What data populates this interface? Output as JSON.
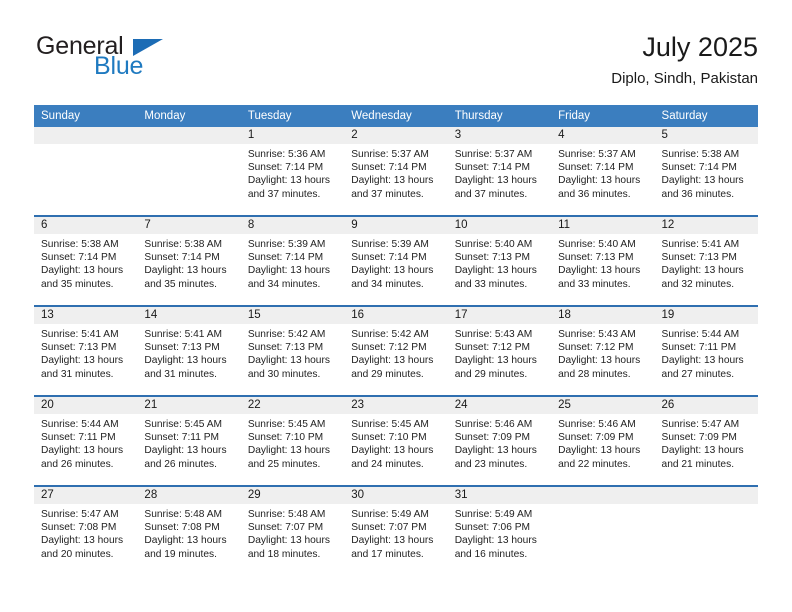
{
  "logo": {
    "word_one": "General",
    "word_two": "Blue",
    "triangle": "blue-triangle-icon"
  },
  "header": {
    "title": "July 2025",
    "location": "Diplo, Sindh, Pakistan"
  },
  "colors": {
    "header_blue": "#3b7ebf",
    "row_divider_blue": "#2f6fb0",
    "daynum_band": "#efefef",
    "logo_blue": "#1f7ac0",
    "text": "#1a1a1a"
  },
  "calendar": {
    "weekday_headers": [
      "Sunday",
      "Monday",
      "Tuesday",
      "Wednesday",
      "Thursday",
      "Friday",
      "Saturday"
    ],
    "weeks": [
      [
        {
          "day": "",
          "sunrise": "",
          "sunset": "",
          "daylight_line1": "",
          "daylight_line2": ""
        },
        {
          "day": "",
          "sunrise": "",
          "sunset": "",
          "daylight_line1": "",
          "daylight_line2": ""
        },
        {
          "day": "1",
          "sunrise": "Sunrise: 5:36 AM",
          "sunset": "Sunset: 7:14 PM",
          "daylight_line1": "Daylight: 13 hours",
          "daylight_line2": "and 37 minutes."
        },
        {
          "day": "2",
          "sunrise": "Sunrise: 5:37 AM",
          "sunset": "Sunset: 7:14 PM",
          "daylight_line1": "Daylight: 13 hours",
          "daylight_line2": "and 37 minutes."
        },
        {
          "day": "3",
          "sunrise": "Sunrise: 5:37 AM",
          "sunset": "Sunset: 7:14 PM",
          "daylight_line1": "Daylight: 13 hours",
          "daylight_line2": "and 37 minutes."
        },
        {
          "day": "4",
          "sunrise": "Sunrise: 5:37 AM",
          "sunset": "Sunset: 7:14 PM",
          "daylight_line1": "Daylight: 13 hours",
          "daylight_line2": "and 36 minutes."
        },
        {
          "day": "5",
          "sunrise": "Sunrise: 5:38 AM",
          "sunset": "Sunset: 7:14 PM",
          "daylight_line1": "Daylight: 13 hours",
          "daylight_line2": "and 36 minutes."
        }
      ],
      [
        {
          "day": "6",
          "sunrise": "Sunrise: 5:38 AM",
          "sunset": "Sunset: 7:14 PM",
          "daylight_line1": "Daylight: 13 hours",
          "daylight_line2": "and 35 minutes."
        },
        {
          "day": "7",
          "sunrise": "Sunrise: 5:38 AM",
          "sunset": "Sunset: 7:14 PM",
          "daylight_line1": "Daylight: 13 hours",
          "daylight_line2": "and 35 minutes."
        },
        {
          "day": "8",
          "sunrise": "Sunrise: 5:39 AM",
          "sunset": "Sunset: 7:14 PM",
          "daylight_line1": "Daylight: 13 hours",
          "daylight_line2": "and 34 minutes."
        },
        {
          "day": "9",
          "sunrise": "Sunrise: 5:39 AM",
          "sunset": "Sunset: 7:14 PM",
          "daylight_line1": "Daylight: 13 hours",
          "daylight_line2": "and 34 minutes."
        },
        {
          "day": "10",
          "sunrise": "Sunrise: 5:40 AM",
          "sunset": "Sunset: 7:13 PM",
          "daylight_line1": "Daylight: 13 hours",
          "daylight_line2": "and 33 minutes."
        },
        {
          "day": "11",
          "sunrise": "Sunrise: 5:40 AM",
          "sunset": "Sunset: 7:13 PM",
          "daylight_line1": "Daylight: 13 hours",
          "daylight_line2": "and 33 minutes."
        },
        {
          "day": "12",
          "sunrise": "Sunrise: 5:41 AM",
          "sunset": "Sunset: 7:13 PM",
          "daylight_line1": "Daylight: 13 hours",
          "daylight_line2": "and 32 minutes."
        }
      ],
      [
        {
          "day": "13",
          "sunrise": "Sunrise: 5:41 AM",
          "sunset": "Sunset: 7:13 PM",
          "daylight_line1": "Daylight: 13 hours",
          "daylight_line2": "and 31 minutes."
        },
        {
          "day": "14",
          "sunrise": "Sunrise: 5:41 AM",
          "sunset": "Sunset: 7:13 PM",
          "daylight_line1": "Daylight: 13 hours",
          "daylight_line2": "and 31 minutes."
        },
        {
          "day": "15",
          "sunrise": "Sunrise: 5:42 AM",
          "sunset": "Sunset: 7:13 PM",
          "daylight_line1": "Daylight: 13 hours",
          "daylight_line2": "and 30 minutes."
        },
        {
          "day": "16",
          "sunrise": "Sunrise: 5:42 AM",
          "sunset": "Sunset: 7:12 PM",
          "daylight_line1": "Daylight: 13 hours",
          "daylight_line2": "and 29 minutes."
        },
        {
          "day": "17",
          "sunrise": "Sunrise: 5:43 AM",
          "sunset": "Sunset: 7:12 PM",
          "daylight_line1": "Daylight: 13 hours",
          "daylight_line2": "and 29 minutes."
        },
        {
          "day": "18",
          "sunrise": "Sunrise: 5:43 AM",
          "sunset": "Sunset: 7:12 PM",
          "daylight_line1": "Daylight: 13 hours",
          "daylight_line2": "and 28 minutes."
        },
        {
          "day": "19",
          "sunrise": "Sunrise: 5:44 AM",
          "sunset": "Sunset: 7:11 PM",
          "daylight_line1": "Daylight: 13 hours",
          "daylight_line2": "and 27 minutes."
        }
      ],
      [
        {
          "day": "20",
          "sunrise": "Sunrise: 5:44 AM",
          "sunset": "Sunset: 7:11 PM",
          "daylight_line1": "Daylight: 13 hours",
          "daylight_line2": "and 26 minutes."
        },
        {
          "day": "21",
          "sunrise": "Sunrise: 5:45 AM",
          "sunset": "Sunset: 7:11 PM",
          "daylight_line1": "Daylight: 13 hours",
          "daylight_line2": "and 26 minutes."
        },
        {
          "day": "22",
          "sunrise": "Sunrise: 5:45 AM",
          "sunset": "Sunset: 7:10 PM",
          "daylight_line1": "Daylight: 13 hours",
          "daylight_line2": "and 25 minutes."
        },
        {
          "day": "23",
          "sunrise": "Sunrise: 5:45 AM",
          "sunset": "Sunset: 7:10 PM",
          "daylight_line1": "Daylight: 13 hours",
          "daylight_line2": "and 24 minutes."
        },
        {
          "day": "24",
          "sunrise": "Sunrise: 5:46 AM",
          "sunset": "Sunset: 7:09 PM",
          "daylight_line1": "Daylight: 13 hours",
          "daylight_line2": "and 23 minutes."
        },
        {
          "day": "25",
          "sunrise": "Sunrise: 5:46 AM",
          "sunset": "Sunset: 7:09 PM",
          "daylight_line1": "Daylight: 13 hours",
          "daylight_line2": "and 22 minutes."
        },
        {
          "day": "26",
          "sunrise": "Sunrise: 5:47 AM",
          "sunset": "Sunset: 7:09 PM",
          "daylight_line1": "Daylight: 13 hours",
          "daylight_line2": "and 21 minutes."
        }
      ],
      [
        {
          "day": "27",
          "sunrise": "Sunrise: 5:47 AM",
          "sunset": "Sunset: 7:08 PM",
          "daylight_line1": "Daylight: 13 hours",
          "daylight_line2": "and 20 minutes."
        },
        {
          "day": "28",
          "sunrise": "Sunrise: 5:48 AM",
          "sunset": "Sunset: 7:08 PM",
          "daylight_line1": "Daylight: 13 hours",
          "daylight_line2": "and 19 minutes."
        },
        {
          "day": "29",
          "sunrise": "Sunrise: 5:48 AM",
          "sunset": "Sunset: 7:07 PM",
          "daylight_line1": "Daylight: 13 hours",
          "daylight_line2": "and 18 minutes."
        },
        {
          "day": "30",
          "sunrise": "Sunrise: 5:49 AM",
          "sunset": "Sunset: 7:07 PM",
          "daylight_line1": "Daylight: 13 hours",
          "daylight_line2": "and 17 minutes."
        },
        {
          "day": "31",
          "sunrise": "Sunrise: 5:49 AM",
          "sunset": "Sunset: 7:06 PM",
          "daylight_line1": "Daylight: 13 hours",
          "daylight_line2": "and 16 minutes."
        },
        {
          "day": "",
          "sunrise": "",
          "sunset": "",
          "daylight_line1": "",
          "daylight_line2": ""
        },
        {
          "day": "",
          "sunrise": "",
          "sunset": "",
          "daylight_line1": "",
          "daylight_line2": ""
        }
      ]
    ]
  }
}
